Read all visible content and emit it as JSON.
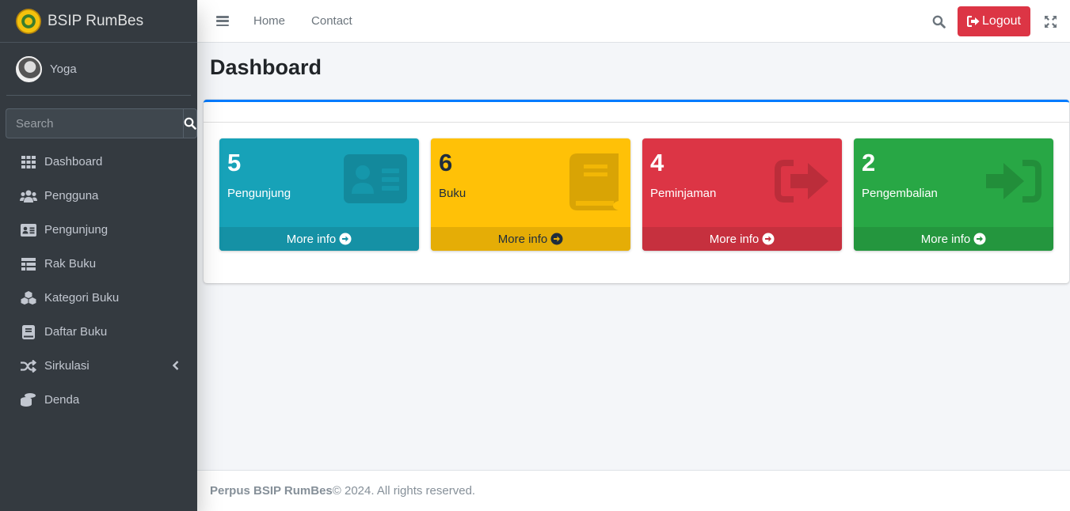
{
  "brand": {
    "name": "BSIP RumBes"
  },
  "user": {
    "name": "Yoga"
  },
  "sidebar": {
    "search_placeholder": "Search",
    "items": [
      {
        "label": "Dashboard",
        "icon": "th-icon"
      },
      {
        "label": "Pengguna",
        "icon": "users-icon"
      },
      {
        "label": "Pengunjung",
        "icon": "id-card-icon"
      },
      {
        "label": "Rak Buku",
        "icon": "table-icon"
      },
      {
        "label": "Kategori Buku",
        "icon": "cubes-icon"
      },
      {
        "label": "Daftar Buku",
        "icon": "book-icon"
      },
      {
        "label": "Sirkulasi",
        "icon": "random-icon"
      },
      {
        "label": "Denda",
        "icon": "coins-icon"
      }
    ]
  },
  "topbar": {
    "links": [
      "Home",
      "Contact"
    ],
    "logout_label": "Logout"
  },
  "page": {
    "title": "Dashboard"
  },
  "stats": [
    {
      "value": "5",
      "label": "Pengunjung",
      "footer": "More info",
      "color": "#17a2b8",
      "icon": "id-card-icon"
    },
    {
      "value": "6",
      "label": "Buku",
      "footer": "More info",
      "color": "#ffc107",
      "icon": "book-icon"
    },
    {
      "value": "4",
      "label": "Peminjaman",
      "footer": "More info",
      "color": "#dc3545",
      "icon": "sign-out-icon"
    },
    {
      "value": "2",
      "label": "Pengembalian",
      "footer": "More info",
      "color": "#28a745",
      "icon": "sign-in-icon"
    }
  ],
  "footer": {
    "brand": "Perpus BSIP RumBes",
    "text": "© 2024. All rights reserved."
  }
}
